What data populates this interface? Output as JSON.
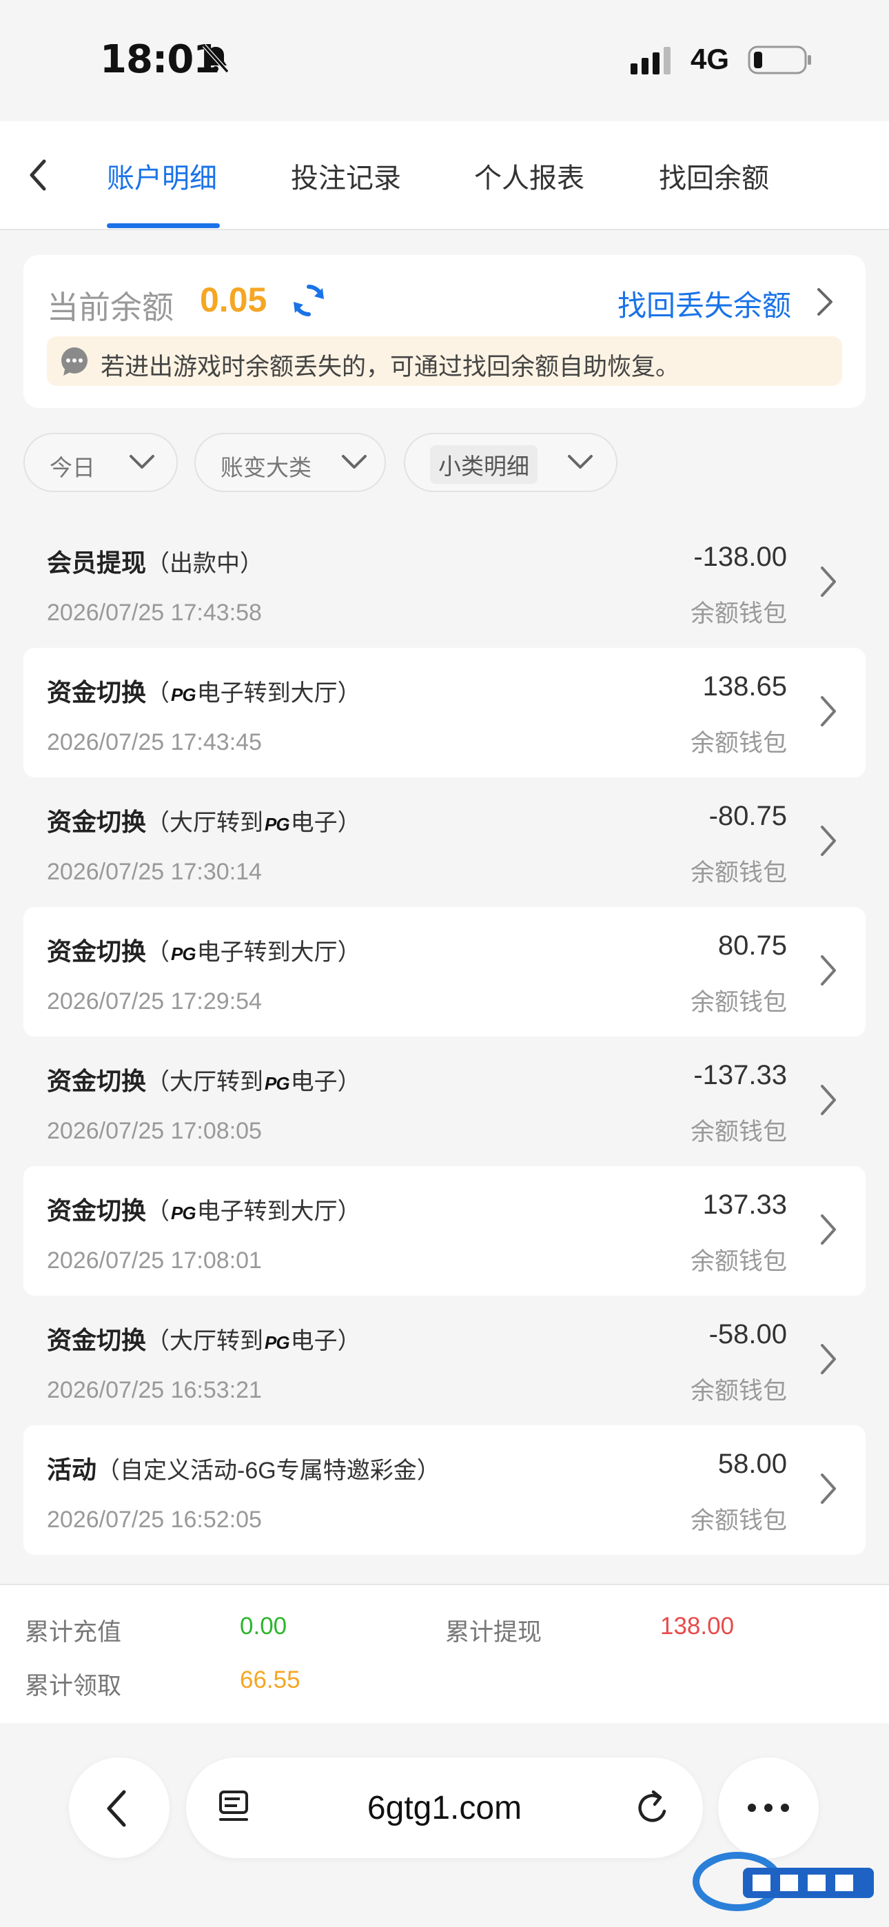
{
  "status_bar": {
    "time": "18:01",
    "network": "4G"
  },
  "tabs": [
    {
      "label": "账户明细",
      "active": true
    },
    {
      "label": "投注记录",
      "active": false
    },
    {
      "label": "个人报表",
      "active": false
    },
    {
      "label": "找回余额",
      "active": false
    }
  ],
  "balance": {
    "label": "当前余额",
    "value": "0.05",
    "recover_link": "找回丢失余额",
    "notice": "若进出游戏时余额丢失的，可通过找回余额自助恢复。"
  },
  "filters": [
    {
      "label": "今日"
    },
    {
      "label": "账变大类"
    },
    {
      "label": "小类明细"
    }
  ],
  "records": [
    {
      "title": "会员提现",
      "detail_pre": "（出款中）",
      "pg": "",
      "detail_post": "",
      "datetime": "2026/07/25 17:43:58",
      "amount": "-138.00",
      "wallet": "余额钱包"
    },
    {
      "title": "资金切换",
      "detail_pre": "（",
      "pg": "PG",
      "detail_post": "电子转到大厅）",
      "datetime": "2026/07/25 17:43:45",
      "amount": "138.65",
      "wallet": "余额钱包"
    },
    {
      "title": "资金切换",
      "detail_pre": "（大厅转到",
      "pg": "PG",
      "detail_post": "电子）",
      "datetime": "2026/07/25 17:30:14",
      "amount": "-80.75",
      "wallet": "余额钱包"
    },
    {
      "title": "资金切换",
      "detail_pre": "（",
      "pg": "PG",
      "detail_post": "电子转到大厅）",
      "datetime": "2026/07/25 17:29:54",
      "amount": "80.75",
      "wallet": "余额钱包"
    },
    {
      "title": "资金切换",
      "detail_pre": "（大厅转到",
      "pg": "PG",
      "detail_post": "电子）",
      "datetime": "2026/07/25 17:08:05",
      "amount": "-137.33",
      "wallet": "余额钱包"
    },
    {
      "title": "资金切换",
      "detail_pre": "（",
      "pg": "PG",
      "detail_post": "电子转到大厅）",
      "datetime": "2026/07/25 17:08:01",
      "amount": "137.33",
      "wallet": "余额钱包"
    },
    {
      "title": "资金切换",
      "detail_pre": "（大厅转到",
      "pg": "PG",
      "detail_post": "电子）",
      "datetime": "2026/07/25 16:53:21",
      "amount": "-58.00",
      "wallet": "余额钱包"
    },
    {
      "title": "活动",
      "detail_pre": "（自定义活动-6G专属特邀彩金）",
      "pg": "",
      "detail_post": "",
      "datetime": "2026/07/25 16:52:05",
      "amount": "58.00",
      "wallet": "余额钱包"
    }
  ],
  "totals": {
    "recharge_label": "累计充值",
    "recharge_value": "0.00",
    "withdraw_label": "累计提现",
    "withdraw_value": "138.00",
    "received_label": "累计领取",
    "received_value": "66.55"
  },
  "browser": {
    "url": "6gtg1.com"
  },
  "colors": {
    "accent": "#1a73e8",
    "balance": "#f5a623",
    "recharge": "#2db52d",
    "withdraw": "#e84a4a",
    "received": "#f5a623"
  }
}
